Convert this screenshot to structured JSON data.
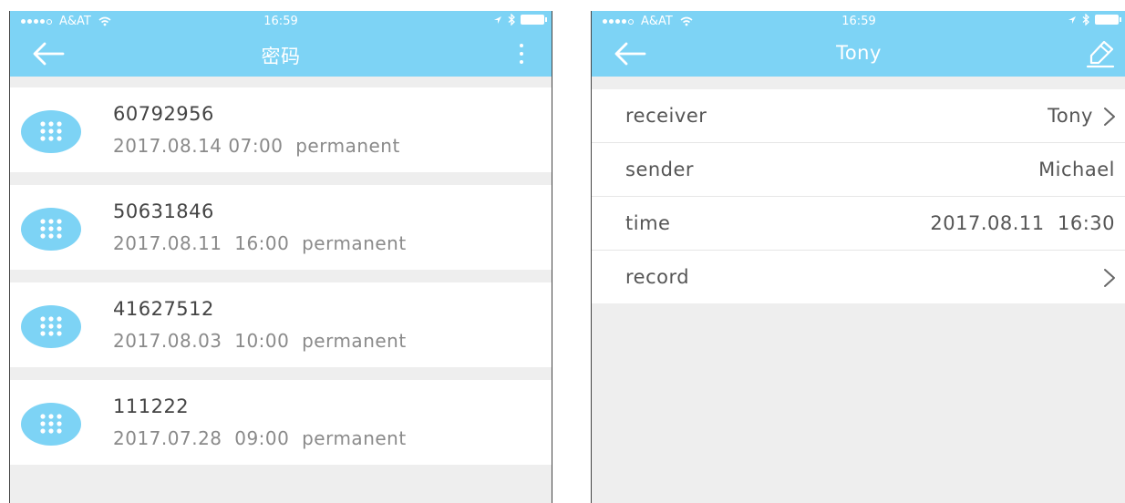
{
  "status_bar": {
    "carrier": "A&AT",
    "time": "16:59"
  },
  "left_screen": {
    "title": "密码",
    "passwords": [
      {
        "code": "60792956",
        "meta": "2017.08.14 07:00  permanent"
      },
      {
        "code": "50631846",
        "meta": "2017.08.11  16:00  permanent"
      },
      {
        "code": "41627512",
        "meta": "2017.08.03  10:00  permanent"
      },
      {
        "code": "111222",
        "meta": "2017.07.28  09:00  permanent"
      }
    ]
  },
  "right_screen": {
    "title": "Tony",
    "rows": {
      "receiver": {
        "label": "receiver",
        "value": "Tony"
      },
      "sender": {
        "label": "sender",
        "value": "Michael"
      },
      "time": {
        "label": "time",
        "value": "2017.08.11  16:30"
      },
      "record": {
        "label": "record"
      }
    }
  },
  "colors": {
    "accent": "#7dd3f5",
    "background": "#eeeeee"
  },
  "icons": [
    "back-arrow-icon",
    "more-vertical-icon",
    "edit-icon",
    "keypad-icon",
    "chevron-right-icon",
    "wifi-icon",
    "bluetooth-icon",
    "location-icon",
    "battery-icon"
  ]
}
